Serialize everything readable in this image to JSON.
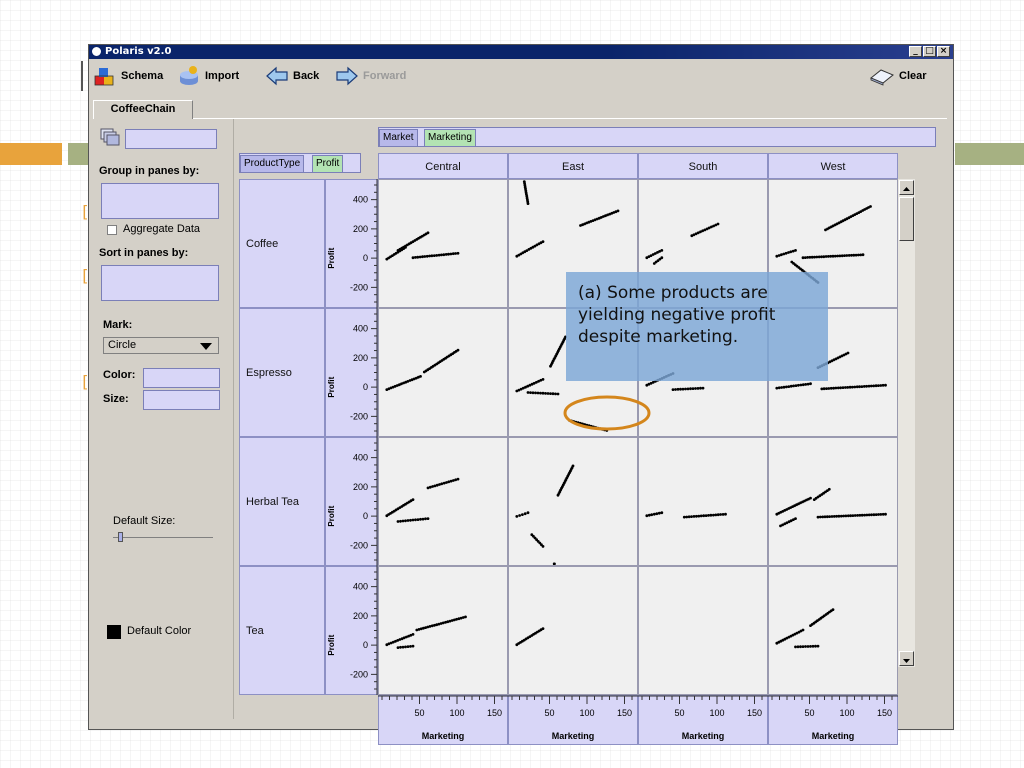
{
  "window": {
    "title": "Polaris v2.0",
    "minimize": "_",
    "maximize": "□",
    "close": "×"
  },
  "toolbar": {
    "schema": "Schema",
    "import": "Import",
    "back": "Back",
    "forward": "Forward",
    "clear": "Clear"
  },
  "tab": {
    "label": "CoffeeChain"
  },
  "left_panel": {
    "group_label": "Group in panes by:",
    "aggregate_label": "Aggregate Data",
    "aggregate_checked": false,
    "sort_label": "Sort in panes by:",
    "mark_label": "Mark:",
    "mark_value": "Circle",
    "color_label": "Color:",
    "size_label": "Size:",
    "default_size_label": "Default Size:",
    "default_size_fraction": 0.05,
    "default_color_label": "Default Color",
    "default_color": "#000000"
  },
  "shelves": {
    "columns": [
      {
        "label": "Market",
        "kind": "dimension"
      },
      {
        "label": "Marketing",
        "kind": "measure"
      }
    ],
    "rows": [
      {
        "label": "ProductType",
        "kind": "dimension"
      },
      {
        "label": "Profit",
        "kind": "measure"
      }
    ]
  },
  "colors": {
    "dimension": "#b7b8ea",
    "measure": "#b3e3b3",
    "header_bg": "#d8d6f7",
    "pane_bg": "#f0f0f0",
    "callout": "#7ba6d6",
    "highlight_ring": "#d4861c"
  },
  "callout": {
    "lines": [
      "(a) Some products are",
      "yielding negative profit",
      "despite marketing."
    ]
  },
  "chart_data": {
    "type": "scatter",
    "markets": [
      "Central",
      "East",
      "South",
      "West"
    ],
    "products": [
      "Coffee",
      "Espresso",
      "Herbal Tea",
      "Tea"
    ],
    "xlabel": "Marketing",
    "ylabel": "Profit",
    "xlim": [
      0,
      160
    ],
    "ylim": [
      -300,
      500
    ],
    "xticks": [
      "50",
      "100",
      "150"
    ],
    "yticks": [
      "400",
      "200",
      "0",
      "-200"
    ],
    "grid": false,
    "panes": [
      {
        "product": "Coffee",
        "market": "Central",
        "clusters": [
          [
            5,
            0,
            30,
            80
          ],
          [
            40,
            10,
            100,
            40
          ],
          [
            20,
            60,
            60,
            180
          ]
        ]
      },
      {
        "product": "Coffee",
        "market": "East",
        "clusters": [
          [
            5,
            20,
            40,
            120
          ],
          [
            90,
            230,
            140,
            330
          ],
          [
            15,
            530,
            20,
            380
          ]
        ]
      },
      {
        "product": "Coffee",
        "market": "South",
        "clusters": [
          [
            5,
            10,
            25,
            60
          ],
          [
            65,
            160,
            100,
            240
          ],
          [
            15,
            -30,
            25,
            10
          ]
        ]
      },
      {
        "product": "Coffee",
        "market": "West",
        "clusters": [
          [
            5,
            20,
            30,
            60
          ],
          [
            40,
            10,
            120,
            30
          ],
          [
            70,
            200,
            130,
            360
          ],
          [
            25,
            -20,
            60,
            -160
          ]
        ]
      },
      {
        "product": "Espresso",
        "market": "Central",
        "clusters": [
          [
            5,
            -10,
            50,
            80
          ],
          [
            55,
            110,
            100,
            260
          ]
        ]
      },
      {
        "product": "Espresso",
        "market": "East",
        "clusters": [
          [
            5,
            -20,
            40,
            60
          ],
          [
            20,
            -30,
            60,
            -40
          ],
          [
            50,
            150,
            70,
            350
          ],
          [
            75,
            -220,
            125,
            -290
          ]
        ]
      },
      {
        "product": "Espresso",
        "market": "South",
        "clusters": [
          [
            5,
            20,
            40,
            100
          ],
          [
            40,
            -10,
            80,
            0
          ]
        ]
      },
      {
        "product": "Espresso",
        "market": "West",
        "clusters": [
          [
            5,
            0,
            50,
            30
          ],
          [
            60,
            140,
            100,
            240
          ],
          [
            65,
            -5,
            150,
            20
          ]
        ]
      },
      {
        "product": "Herbal Tea",
        "market": "Central",
        "clusters": [
          [
            5,
            10,
            40,
            120
          ],
          [
            60,
            200,
            100,
            260
          ],
          [
            20,
            -30,
            60,
            -10
          ]
        ]
      },
      {
        "product": "Herbal Tea",
        "market": "East",
        "clusters": [
          [
            5,
            5,
            20,
            30
          ],
          [
            25,
            -120,
            40,
            -200
          ],
          [
            60,
            150,
            80,
            350
          ],
          [
            55,
            -320,
            55,
            -320
          ]
        ]
      },
      {
        "product": "Herbal Tea",
        "market": "South",
        "clusters": [
          [
            5,
            10,
            25,
            30
          ],
          [
            55,
            0,
            110,
            20
          ]
        ]
      },
      {
        "product": "Herbal Tea",
        "market": "West",
        "clusters": [
          [
            5,
            20,
            50,
            130
          ],
          [
            55,
            120,
            75,
            190
          ],
          [
            60,
            0,
            150,
            20
          ],
          [
            10,
            -60,
            30,
            -10
          ]
        ]
      },
      {
        "product": "Tea",
        "market": "Central",
        "clusters": [
          [
            5,
            10,
            40,
            80
          ],
          [
            45,
            110,
            110,
            200
          ],
          [
            20,
            -10,
            40,
            0
          ]
        ]
      },
      {
        "product": "Tea",
        "market": "East",
        "clusters": [
          [
            5,
            10,
            40,
            120
          ]
        ]
      },
      {
        "product": "Tea",
        "market": "South",
        "clusters": []
      },
      {
        "product": "Tea",
        "market": "West",
        "clusters": [
          [
            5,
            20,
            40,
            110
          ],
          [
            50,
            140,
            80,
            250
          ],
          [
            30,
            -5,
            60,
            0
          ]
        ]
      }
    ]
  }
}
